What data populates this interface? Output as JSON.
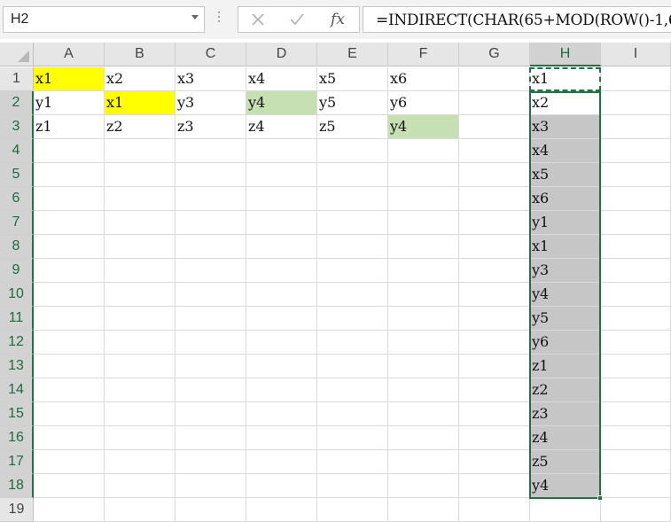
{
  "name_box": {
    "value": "H2"
  },
  "formula_bar": {
    "cancel_icon": "cancel-x-icon",
    "enter_icon": "checkmark-icon",
    "function_label": "fx",
    "formula": "=INDIRECT(CHAR(65+MOD(ROW()-1,6"
  },
  "columns": [
    "A",
    "B",
    "C",
    "D",
    "E",
    "F",
    "G",
    "H",
    "I"
  ],
  "selected_column": "H",
  "rows": [
    "1",
    "2",
    "3",
    "4",
    "5",
    "6",
    "7",
    "8",
    "9",
    "10",
    "11",
    "12",
    "13",
    "14",
    "15",
    "16",
    "17",
    "18",
    "19"
  ],
  "selected_rows": [
    "2",
    "3",
    "4",
    "5",
    "6",
    "7",
    "8",
    "9",
    "10",
    "11",
    "12",
    "13",
    "14",
    "15",
    "16",
    "17",
    "18"
  ],
  "active_cell": "H2",
  "copy_marquee_cell": "H1",
  "colors": {
    "yellow": "#ffff00",
    "green": "#c6e0b4",
    "selection_gray": "#c6c6c6",
    "excel_green": "#217346"
  },
  "cells": {
    "A1": "x1",
    "B1": "x2",
    "C1": "x3",
    "D1": "x4",
    "E1": "x5",
    "F1": "x6",
    "A2": "y1",
    "B2": "x1",
    "C2": "y3",
    "D2": "y4",
    "E2": "y5",
    "F2": "y6",
    "A3": "z1",
    "B3": "z2",
    "C3": "z3",
    "D3": "z4",
    "E3": "z5",
    "F3": "y4",
    "H1": "x1",
    "H2": "x2",
    "H3": "x3",
    "H4": "x4",
    "H5": "x5",
    "H6": "x6",
    "H7": "y1",
    "H8": "x1",
    "H9": "y3",
    "H10": "y4",
    "H11": "y5",
    "H12": "y6",
    "H13": "z1",
    "H14": "z2",
    "H15": "z3",
    "H16": "z4",
    "H17": "z5",
    "H18": "y4"
  },
  "cell_fills": {
    "A1": "yellow",
    "B2": "yellow",
    "D2": "green",
    "F3": "green"
  }
}
